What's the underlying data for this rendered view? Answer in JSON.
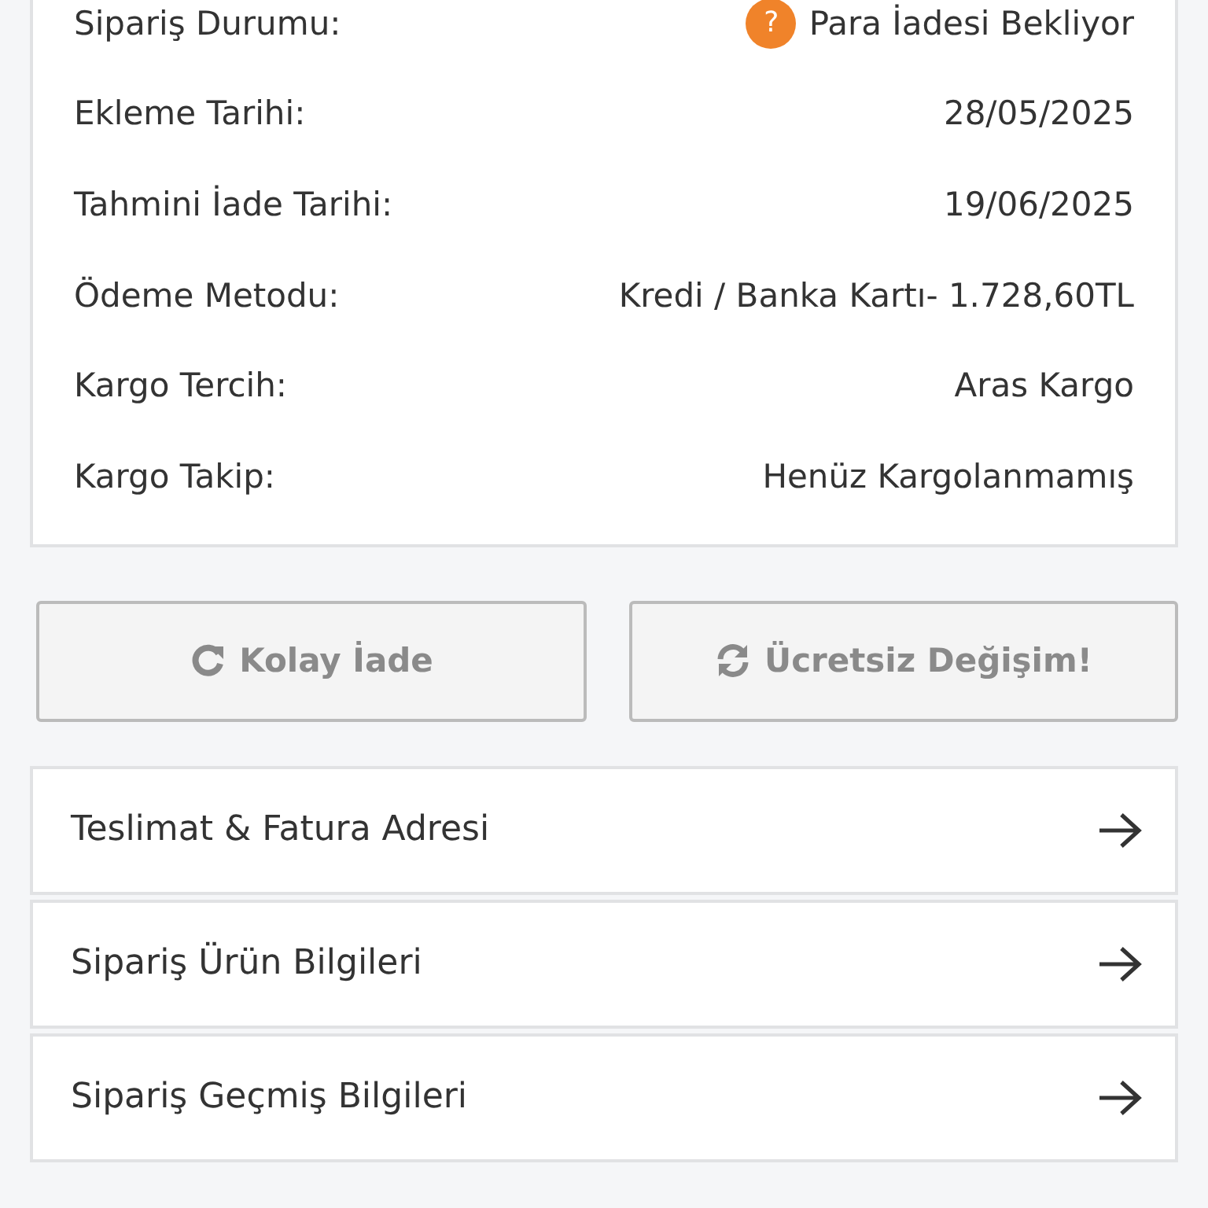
{
  "details": [
    {
      "label": "Sipariş Durumu:",
      "value": "Para İadesi Bekliyor",
      "icon": "?"
    },
    {
      "label": "Ekleme Tarihi:",
      "value": "28/05/2025"
    },
    {
      "label": "Tahmini İade Tarihi:",
      "value": "19/06/2025"
    },
    {
      "label": "Ödeme Metodu:",
      "value": "Kredi / Banka Kartı- 1.728,60TL"
    },
    {
      "label": "Kargo Tercih:",
      "value": "Aras Kargo"
    },
    {
      "label": "Kargo Takip:",
      "value": "Henüz Kargolanmamış"
    }
  ],
  "buttons": [
    {
      "label": "Kolay İade",
      "kind": "redo",
      "disabled": true
    },
    {
      "label": "Ücretsiz Değişim!",
      "kind": "sync",
      "disabled": true
    }
  ],
  "links": [
    "Teslimat & Fatura Adresi",
    "Sipariş Ürün Bilgileri",
    "Sipariş Geçmiş Bilgileri"
  ]
}
